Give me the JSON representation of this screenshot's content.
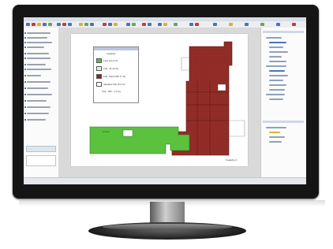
{
  "legend": {
    "title": "Capacity",
    "items": [
      {
        "label": "Free (10.0 %)",
        "color": "#5ac23f"
      },
      {
        "label": "Full - (5-10 %)",
        "color": "#e9eef5"
      },
      {
        "label": "Full - Rsvd (89.77 %)",
        "color": "#8b2621"
      },
      {
        "label": "Vacated Unit (0.2 %)",
        "color": "#ffffff"
      },
      {
        "label": "Unit - NIF - 1.0 sq",
        "color": "#ffffff"
      }
    ]
  },
  "map": {
    "label_area": "Capacity A",
    "label_green": "Area A"
  },
  "colors": {
    "green": "#5ac23f",
    "red": "#8e2a24",
    "accent": "#4a74b8"
  }
}
